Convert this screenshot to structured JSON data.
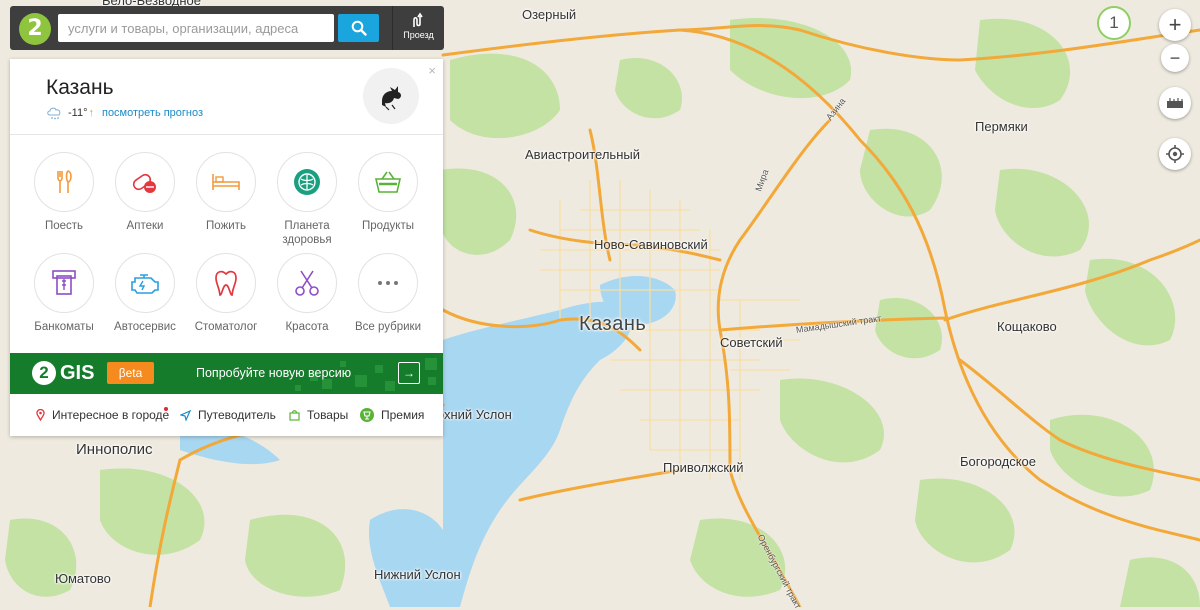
{
  "search": {
    "placeholder": "услуги и товары, организации, адреса",
    "route_label": "Проезд"
  },
  "panel": {
    "city": "Казань",
    "temperature": "-11°",
    "temp_trend": "↑",
    "forecast_link": "посмотреть прогноз",
    "close": "×",
    "categories": [
      {
        "label": "Поесть",
        "icon": "fork-knife-icon",
        "color": "#f39a3c"
      },
      {
        "label": "Аптеки",
        "icon": "pills-icon",
        "color": "#e2383f"
      },
      {
        "label": "Пожить",
        "icon": "bed-icon",
        "color": "#f39a3c"
      },
      {
        "label": "Планета здоровья",
        "icon": "health-planet-icon",
        "color": "#19a080"
      },
      {
        "label": "Продукты",
        "icon": "basket-icon",
        "color": "#59b339"
      },
      {
        "label": "Банкоматы",
        "icon": "atm-icon",
        "color": "#8e4ec6"
      },
      {
        "label": "Автосервис",
        "icon": "engine-icon",
        "color": "#2b9ede"
      },
      {
        "label": "Стоматолог",
        "icon": "tooth-icon",
        "color": "#e2383f"
      },
      {
        "label": "Красота",
        "icon": "scissors-icon",
        "color": "#8e4ec6"
      },
      {
        "label": "Все рубрики",
        "icon": "more-icon",
        "color": "#777777"
      }
    ],
    "banner": {
      "brand": "GIS",
      "brand_digit": "2",
      "badge": "βeta",
      "text": "Попробуйте новую версию",
      "arrow": "→"
    },
    "links": [
      {
        "label": "Интересное в городе",
        "icon": "pin-icon"
      },
      {
        "label": "Путеводитель",
        "icon": "navigation-icon"
      },
      {
        "label": "Товары",
        "icon": "bag-icon"
      },
      {
        "label": "Премия",
        "icon": "award-icon"
      }
    ]
  },
  "controls": {
    "layer_count": "1",
    "zoom_in": "+",
    "zoom_out": "−"
  },
  "map_labels": [
    {
      "text": "Озерный",
      "cls": ""
    },
    {
      "text": "Авиастроительный",
      "cls": ""
    },
    {
      "text": "Ново-Савиновский",
      "cls": ""
    },
    {
      "text": "Казань",
      "cls": "big"
    },
    {
      "text": "Советский",
      "cls": ""
    },
    {
      "text": "Пермяки",
      "cls": ""
    },
    {
      "text": "Кощаково",
      "cls": ""
    },
    {
      "text": "Богородское",
      "cls": ""
    },
    {
      "text": "Приволжский",
      "cls": ""
    },
    {
      "text": "Иннополис",
      "cls": "mid"
    },
    {
      "text": "Верхний Услон",
      "cls": ""
    },
    {
      "text": "Нижний Услон",
      "cls": ""
    },
    {
      "text": "Юматово",
      "cls": ""
    },
    {
      "text": "Бело-Безводное",
      "cls": ""
    }
  ],
  "road_labels": [
    "Азина",
    "Мира",
    "Мамадышский тракт",
    "Оренбургский тракт"
  ],
  "colors": {
    "land": "#efeadf",
    "forest": "#bfe0a0",
    "water": "#a7d6f0",
    "road": "#f2a93a",
    "street": "#f6e2b0",
    "dark": "#3e3e3e",
    "accent": "#1aa5de",
    "banner": "#157c2b"
  }
}
